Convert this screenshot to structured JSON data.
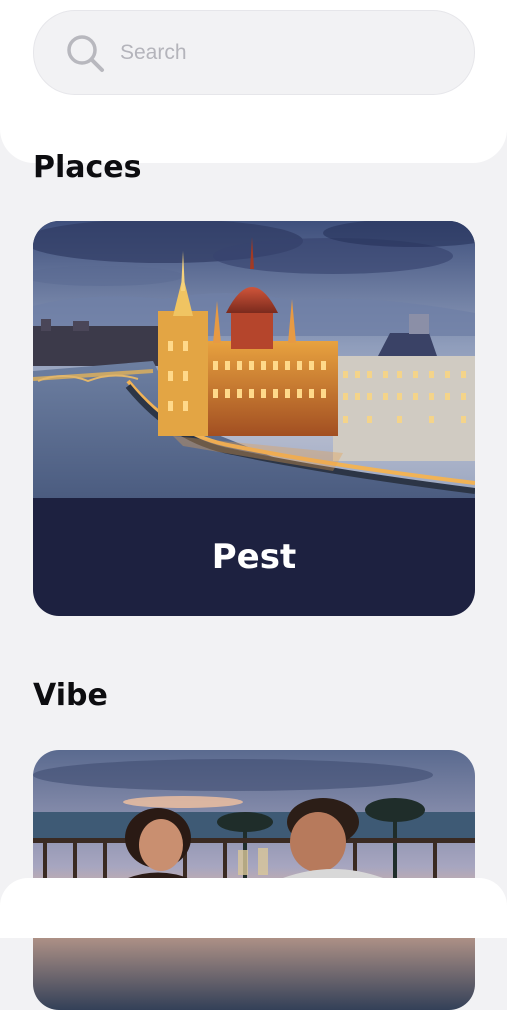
{
  "search": {
    "placeholder": "Search"
  },
  "sections": {
    "places_title": "Places",
    "vibe_title": "Vibe"
  },
  "places": [
    {
      "label": "Pest"
    }
  ],
  "icons": {
    "search": "search-icon"
  },
  "colors": {
    "background": "#f2f2f4",
    "card_label_bg": "#1d2140",
    "card_label_text": "#ffffff",
    "placeholder": "#b4b4bb"
  }
}
